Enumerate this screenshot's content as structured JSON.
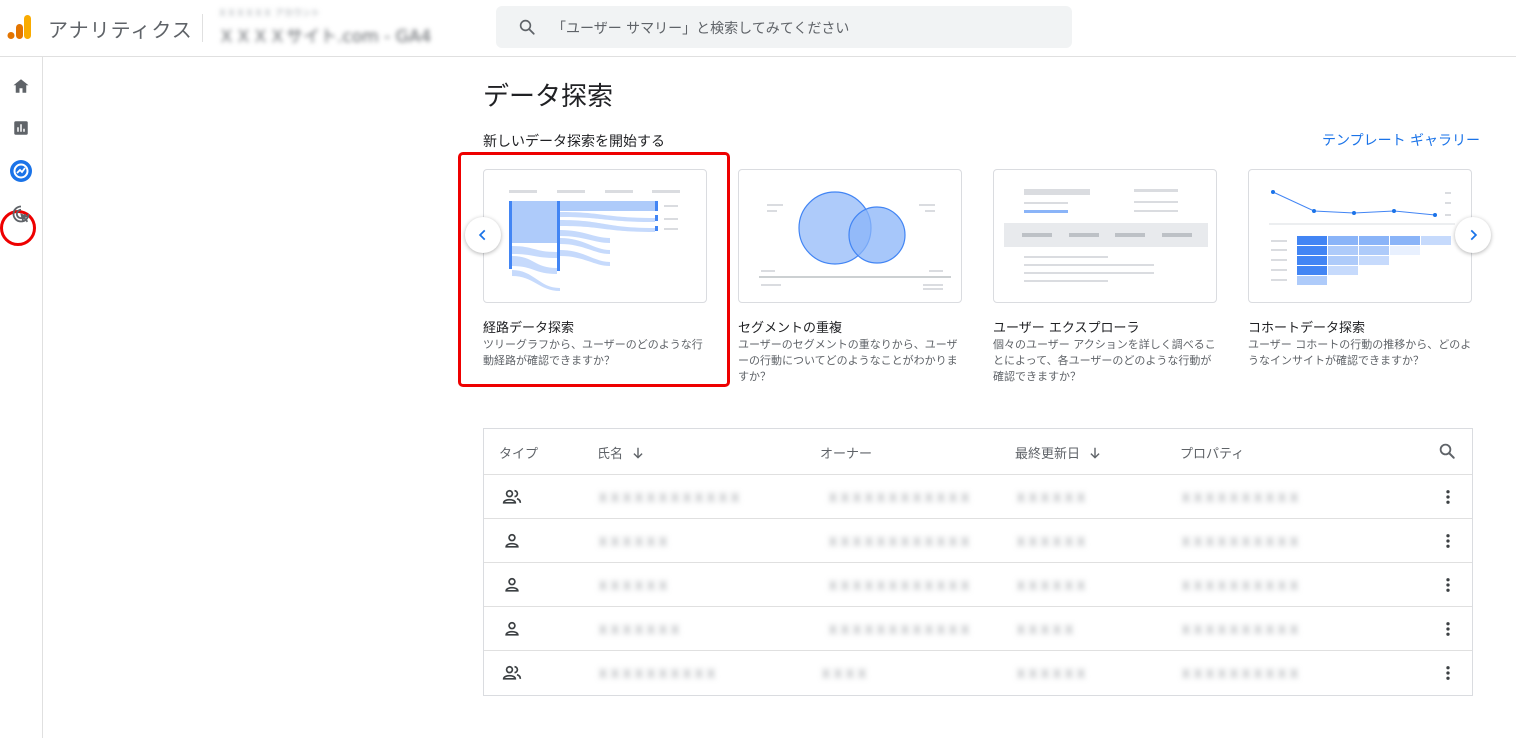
{
  "header": {
    "app_title": "アナリティクス",
    "account_line": "ＸＸＸＸＸＸ アカウント",
    "property_line": "ＸＸＸＸサイト.com - GA4",
    "search_placeholder": "「ユーザー サマリー」と検索してみてください"
  },
  "nav": {
    "items": [
      {
        "name": "home",
        "icon": "home-icon"
      },
      {
        "name": "reports",
        "icon": "bar-chart-icon"
      },
      {
        "name": "explore",
        "icon": "explore-icon",
        "active": true
      },
      {
        "name": "advertising",
        "icon": "cursor-target-icon"
      }
    ]
  },
  "main": {
    "title": "データ探索",
    "new_section_title": "新しいデータ探索を開始する",
    "gallery_link": "テンプレート ギャラリー",
    "cards": [
      {
        "name": "経路データ探索",
        "desc": "ツリーグラフから、ユーザーのどのような行動経路が確認できますか？"
      },
      {
        "name": "セグメントの重複",
        "desc": "ユーザーのセグメントの重なりから、ユーザーの行動についてどのようなことがわかりますか？"
      },
      {
        "name": "ユーザー エクスプローラ",
        "desc": "個々のユーザー アクションを詳しく調べることによって、各ユーザーのどのような行動が確認できますか？"
      },
      {
        "name": "コホートデータ探索",
        "desc": "ユーザー コホートの行動の推移から、どのようなインサイトが確認できますか？"
      }
    ]
  },
  "table": {
    "headers": {
      "type": "タイプ",
      "name": "氏名",
      "owner": "オーナー",
      "updated": "最終更新日",
      "property": "プロパティ"
    },
    "rows": [
      {
        "type_icon": "shared-users-icon",
        "name": "ＸＸＸＸＸＸＸＸＸＸＸＸ",
        "owner": "ＸＸＸＸＸＸＸＸＸＸＸＸ",
        "updated": "ＸＸＸＸＸＸ",
        "property": "ＸＸＸＸＸＸＸＸＸＸ"
      },
      {
        "type_icon": "user-icon",
        "name": "ＸＸＸＸＸＸ",
        "owner": "ＸＸＸＸＸＸＸＸＸＸＸＸ",
        "updated": "ＸＸＸＸＸＸ",
        "property": "ＸＸＸＸＸＸＸＸＸＸ"
      },
      {
        "type_icon": "user-icon",
        "name": "ＸＸＸＸＸＸ",
        "owner": "ＸＸＸＸＸＸＸＸＸＸＸＸ",
        "updated": "ＸＸＸＸＸＸ",
        "property": "ＸＸＸＸＸＸＸＸＸＸ"
      },
      {
        "type_icon": "user-icon",
        "name": "ＸＸＸＸＸＸＸ",
        "owner": "ＸＸＸＸＸＸＸＸＸＸＸＸ",
        "updated": "ＸＸＸＸＸ",
        "property": "ＸＸＸＸＸＸＸＸＸＸ"
      },
      {
        "type_icon": "shared-users-icon",
        "name": "ＸＸＸＸＸＸＸＸＸＸ",
        "owner": "ＸＸＸＸ",
        "updated": "ＸＸＸＸＸＸ",
        "property": "ＸＸＸＸＸＸＸＸＸＸ"
      }
    ]
  },
  "colors": {
    "brand_orange": "#f9ab00",
    "brand_dark_orange": "#e37400",
    "accent_blue": "#1a73e8",
    "highlight_red": "#ee0000"
  }
}
